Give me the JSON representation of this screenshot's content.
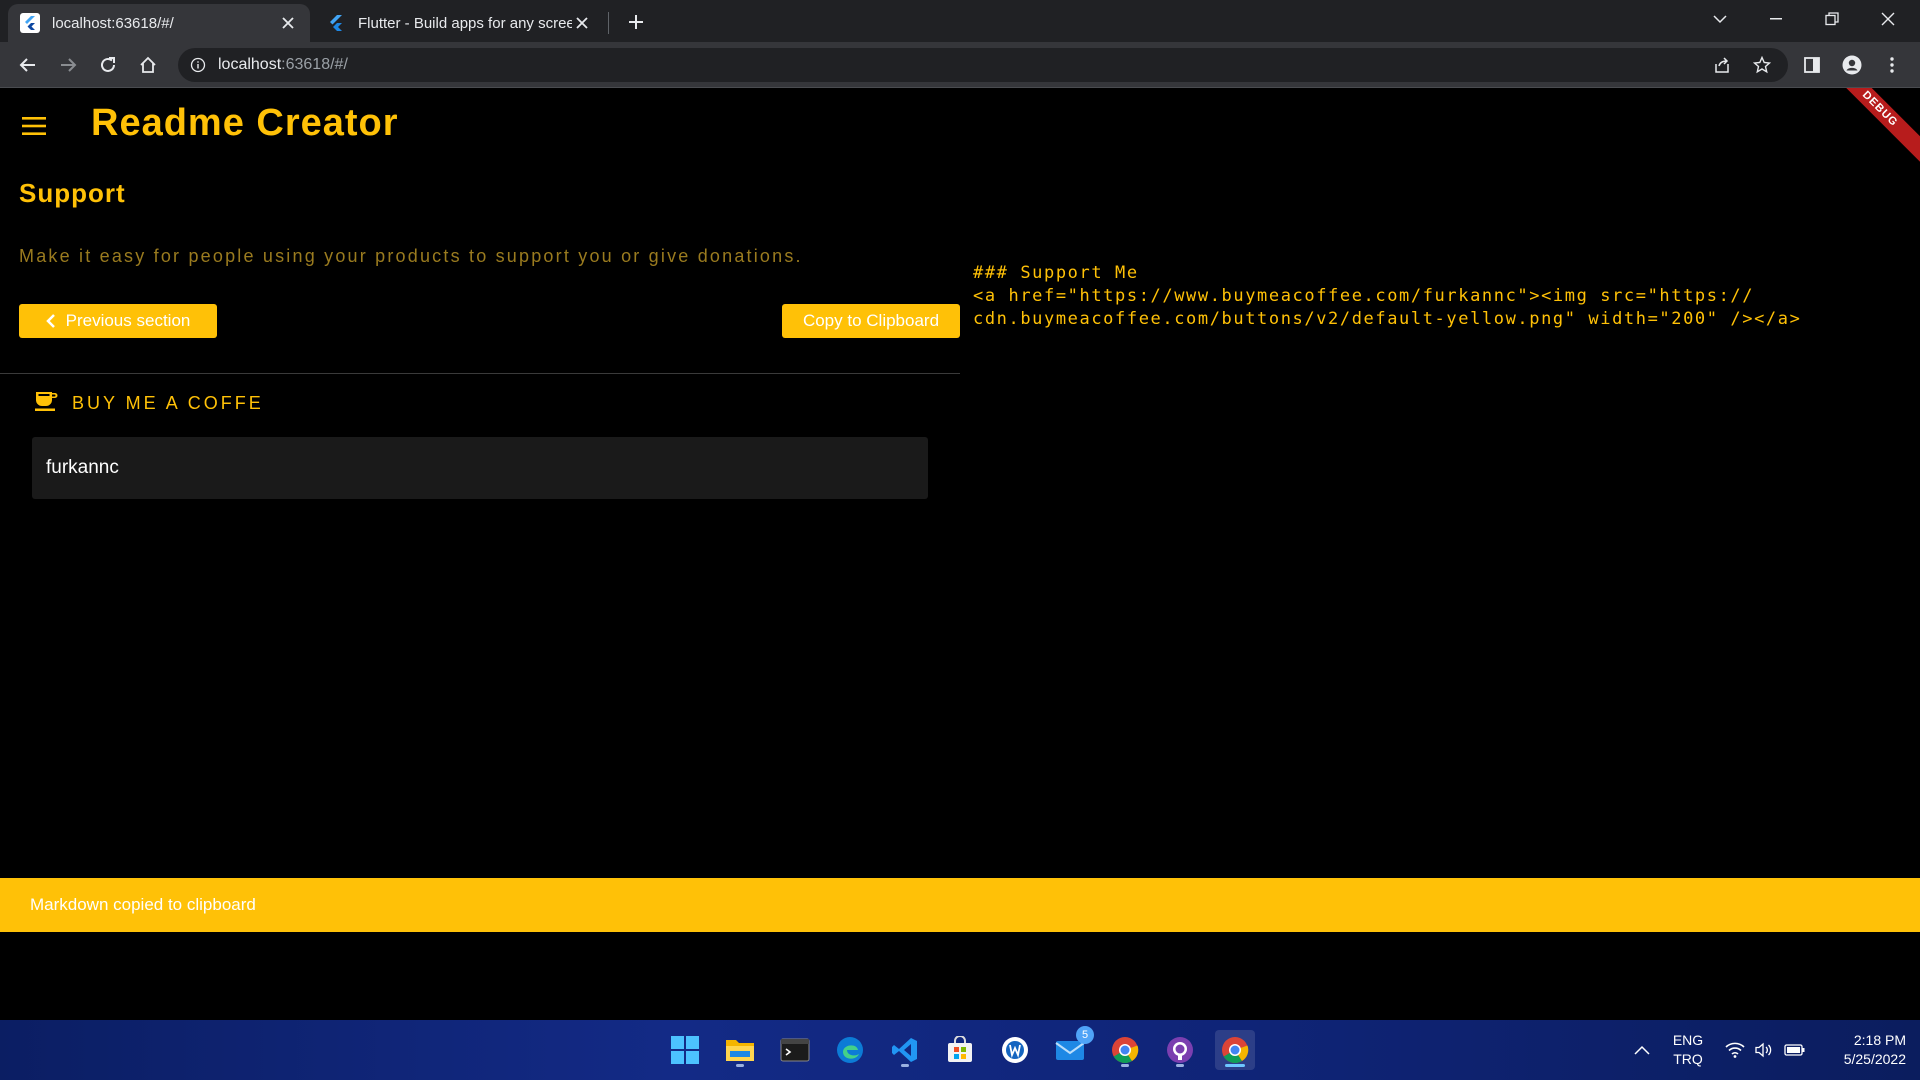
{
  "browser": {
    "tabs": [
      {
        "title": "localhost:63618/#/",
        "active": true
      },
      {
        "title": "Flutter - Build apps for any screen",
        "active": false
      }
    ],
    "address": {
      "host": "localhost",
      "rest": ":63618/#/"
    }
  },
  "app": {
    "title": "Readme Creator",
    "debug_label": "DEBUG",
    "section": {
      "title": "Support",
      "description": "Make it easy for people using your products to support you or give donations."
    },
    "buttons": {
      "previous": "Previous section",
      "copy": "Copy to Clipboard"
    },
    "field": {
      "label": "BUY ME A COFFE",
      "value": "furkannc"
    },
    "markdown": {
      "line1": "### Support Me",
      "line2": "<a href=\"https://www.buymeacoffee.com/furkannc\"><img src=\"https://",
      "line3": "cdn.buymeacoffee.com/buttons/v2/default-yellow.png\" width=\"200\" /></a>"
    },
    "snackbar": "Markdown copied to clipboard",
    "accent_color": "#ffc107"
  },
  "taskbar": {
    "mail_badge": "5",
    "language": {
      "line1": "ENG",
      "line2": "TRQ"
    },
    "clock": {
      "time": "2:18 PM",
      "date": "5/25/2022"
    }
  }
}
